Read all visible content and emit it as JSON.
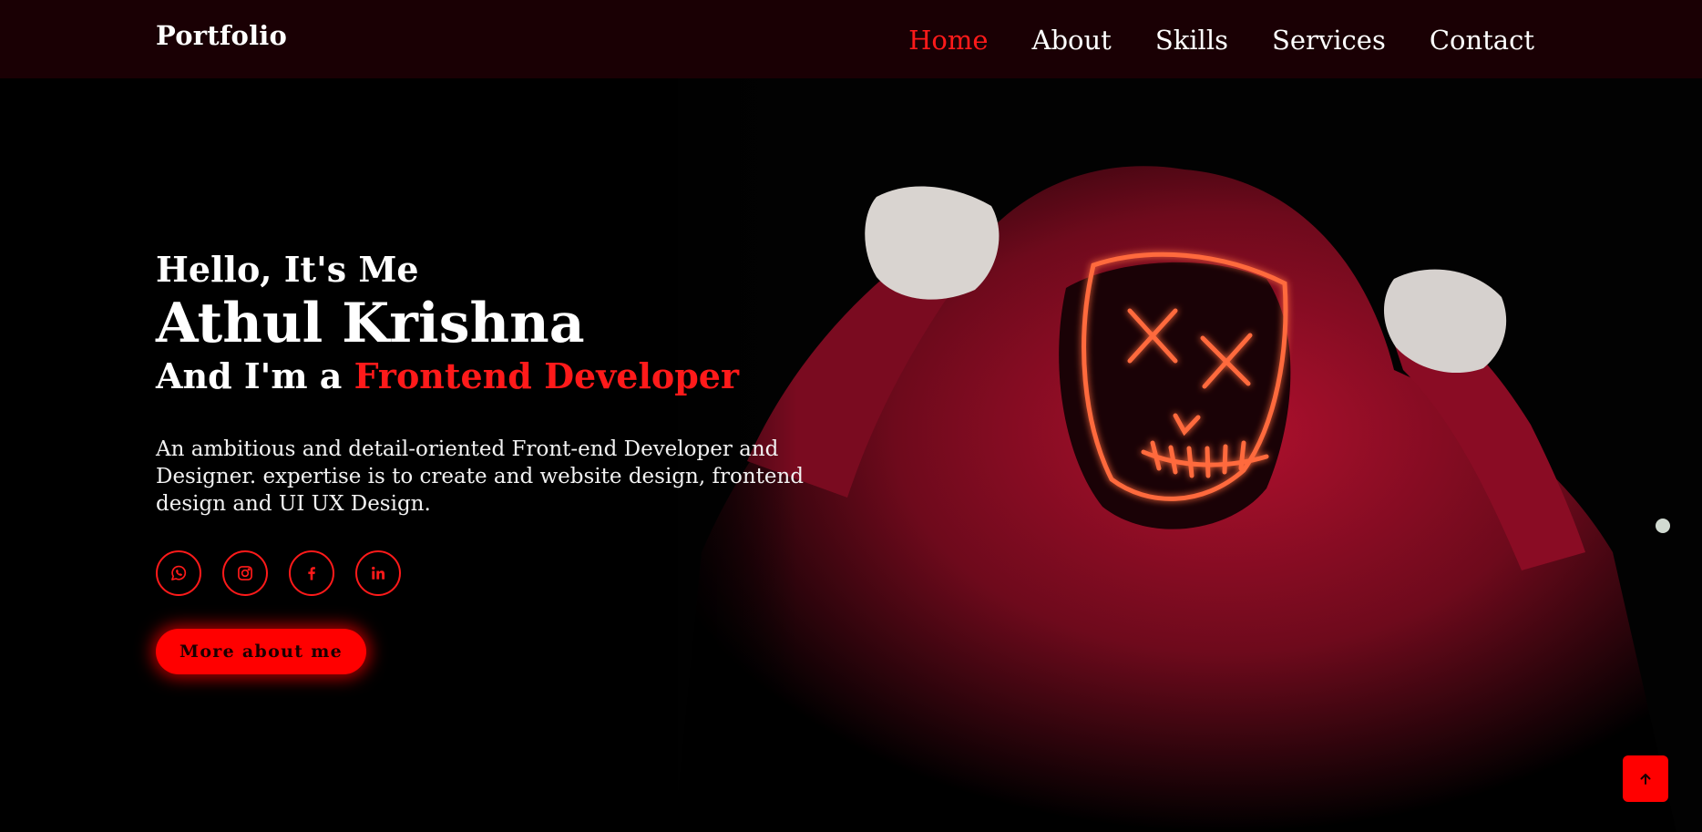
{
  "header": {
    "logo": "Portfolio",
    "nav": [
      {
        "label": "Home",
        "active": true
      },
      {
        "label": "About",
        "active": false
      },
      {
        "label": "Skills",
        "active": false
      },
      {
        "label": "Services",
        "active": false
      },
      {
        "label": "Contact",
        "active": false
      }
    ]
  },
  "hero": {
    "greeting": "Hello, It's Me",
    "name": "Athul Krishna",
    "role_prefix": "And I'm a ",
    "role_highlight": "Frontend Developer",
    "description": "An ambitious and detail-oriented Front-end Developer and Designer. expertise is to create and website design, frontend design and UI UX Design.",
    "socials": [
      {
        "icon": "whatsapp-icon"
      },
      {
        "icon": "instagram-icon"
      },
      {
        "icon": "facebook-icon"
      },
      {
        "icon": "linkedin-icon"
      }
    ],
    "cta_label": "More about me"
  },
  "back_to_top": {
    "icon": "arrow-up-icon"
  },
  "colors": {
    "accent": "#ff1a1a",
    "header_bg": "#1a0004",
    "background": "#000000"
  }
}
